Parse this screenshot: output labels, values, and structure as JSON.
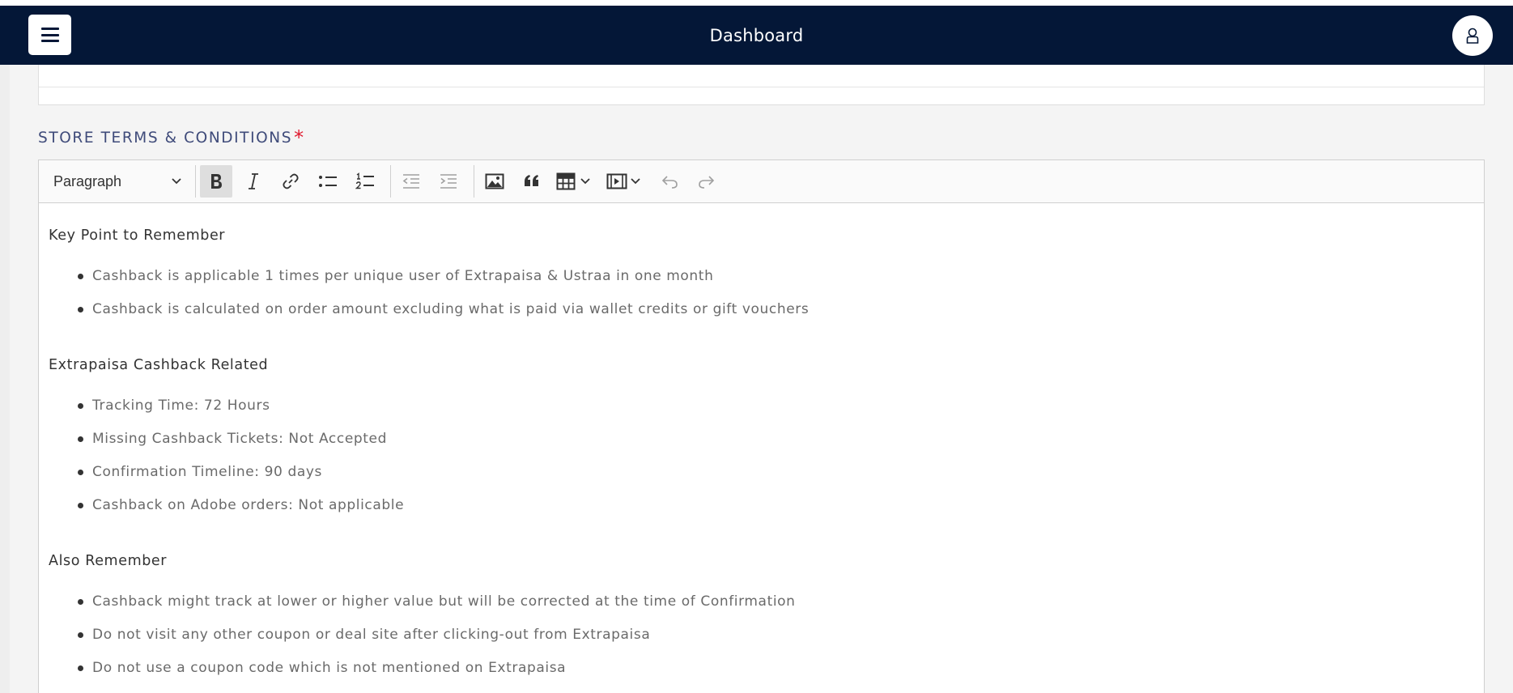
{
  "navbar": {
    "title": "Dashboard",
    "menu_icon": "hamburger-icon",
    "user_icon": "user-icon",
    "background": "#041737"
  },
  "section": {
    "label": "STORE TERMS & CONDITIONS",
    "required_marker": "*",
    "label_color": "#3f4b7a",
    "required_color": "#e0182d"
  },
  "toolbar": {
    "heading_select": "Paragraph",
    "buttons": [
      "bold",
      "italic",
      "link",
      "bulleted-list",
      "numbered-list",
      "outdent",
      "indent",
      "insert-image",
      "block-quote",
      "insert-table",
      "insert-media",
      "undo",
      "redo"
    ],
    "active": "bold"
  },
  "editor": {
    "sections": [
      {
        "heading": "Key Point to Remember",
        "items": [
          "Cashback is applicable 1 times per unique user of Extrapaisa & Ustraa in one month",
          "Cashback is calculated on order amount excluding what is paid via wallet credits or gift vouchers"
        ]
      },
      {
        "heading": "Extrapaisa Cashback Related",
        "items": [
          "Tracking Time: 72 Hours",
          "Missing Cashback Tickets: Not Accepted",
          "Confirmation Timeline: 90 days",
          "Cashback on Adobe orders: Not applicable"
        ]
      },
      {
        "heading": "Also Remember",
        "items": [
          "Cashback might track at lower or higher value but will be corrected at the time of Confirmation",
          "Do not visit any other coupon or deal site after clicking-out from Extrapaisa",
          "Do not use a coupon code which is not mentioned on Extrapaisa"
        ]
      }
    ]
  }
}
